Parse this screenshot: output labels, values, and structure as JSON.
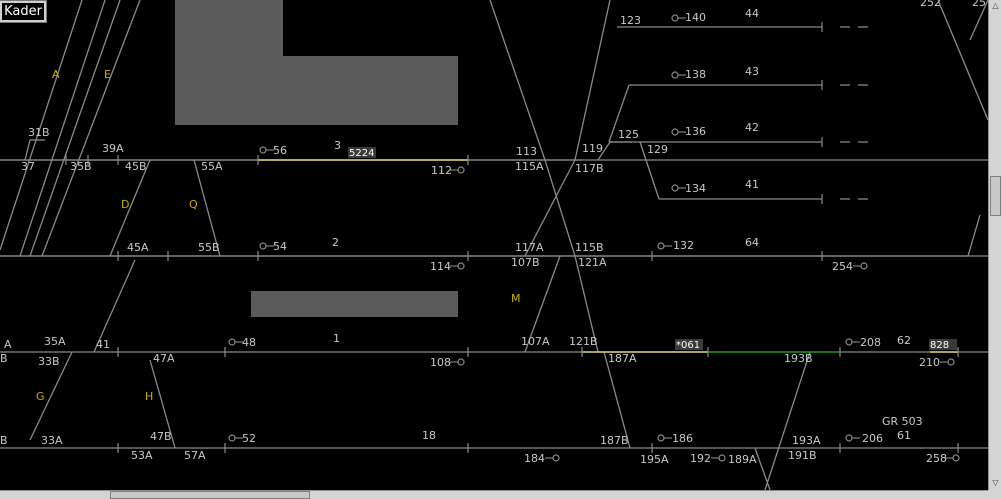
{
  "toolbar": {
    "kader_label": "Kader"
  },
  "colors": {
    "track": "#8a8a8a",
    "occupied": "#d8d070",
    "set_route": "#1a8a1a",
    "block": "#5a5a5a",
    "switch_label": "#c8b000",
    "text": "#c8c8c8"
  },
  "train_numbers": [
    "5224",
    "*061",
    "828"
  ],
  "switch_labels": [
    "A",
    "E",
    "D",
    "Q",
    "M",
    "G",
    "H"
  ],
  "track_labels": [
    "3",
    "2",
    "1",
    "18",
    "44",
    "43",
    "42",
    "41",
    "64",
    "62",
    "61",
    "GR 503"
  ],
  "switch_numbers": [
    "31B",
    "37",
    "35B",
    "39A",
    "45B",
    "55A",
    "45A",
    "55B",
    "41",
    "35A",
    "33B",
    "47A",
    "33A",
    "47B",
    "53A",
    "57A",
    "113",
    "115A",
    "117B",
    "119",
    "123",
    "125",
    "129",
    "117A",
    "107B",
    "115B",
    "121A",
    "107A",
    "121B",
    "187A",
    "193B",
    "187B",
    "195A",
    "189A",
    "191B",
    "193A",
    "252",
    "25",
    "B",
    "A",
    "B"
  ],
  "signals": [
    "56",
    "54",
    "48",
    "52",
    "112",
    "114",
    "108",
    "184",
    "140",
    "138",
    "136",
    "134",
    "132",
    "254",
    "208",
    "210",
    "186",
    "192",
    "206",
    "258"
  ],
  "scroll": {
    "vertical_up": "△",
    "vertical_down": "▽",
    "horizontal_right": "▷"
  }
}
